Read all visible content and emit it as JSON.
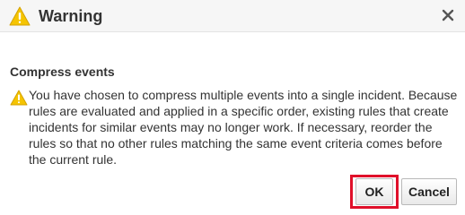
{
  "dialog": {
    "title": "Warning",
    "icon": "warning-icon",
    "close_icon": "close-icon"
  },
  "content": {
    "heading": "Compress events",
    "message_icon": "warning-icon",
    "message": "You have chosen to compress multiple events into a single incident. Because rules are evaluated and applied in a specific order, existing rules that create incidents for similar events may no longer work. If necessary, reorder the rules so that no other rules matching the same event criteria comes before the current rule."
  },
  "buttons": {
    "ok_label": "OK",
    "cancel_label": "Cancel"
  },
  "colors": {
    "warning_yellow": "#f5c400",
    "highlight_red": "#e0102a",
    "titlebar_bg": "#f6f6f6"
  }
}
